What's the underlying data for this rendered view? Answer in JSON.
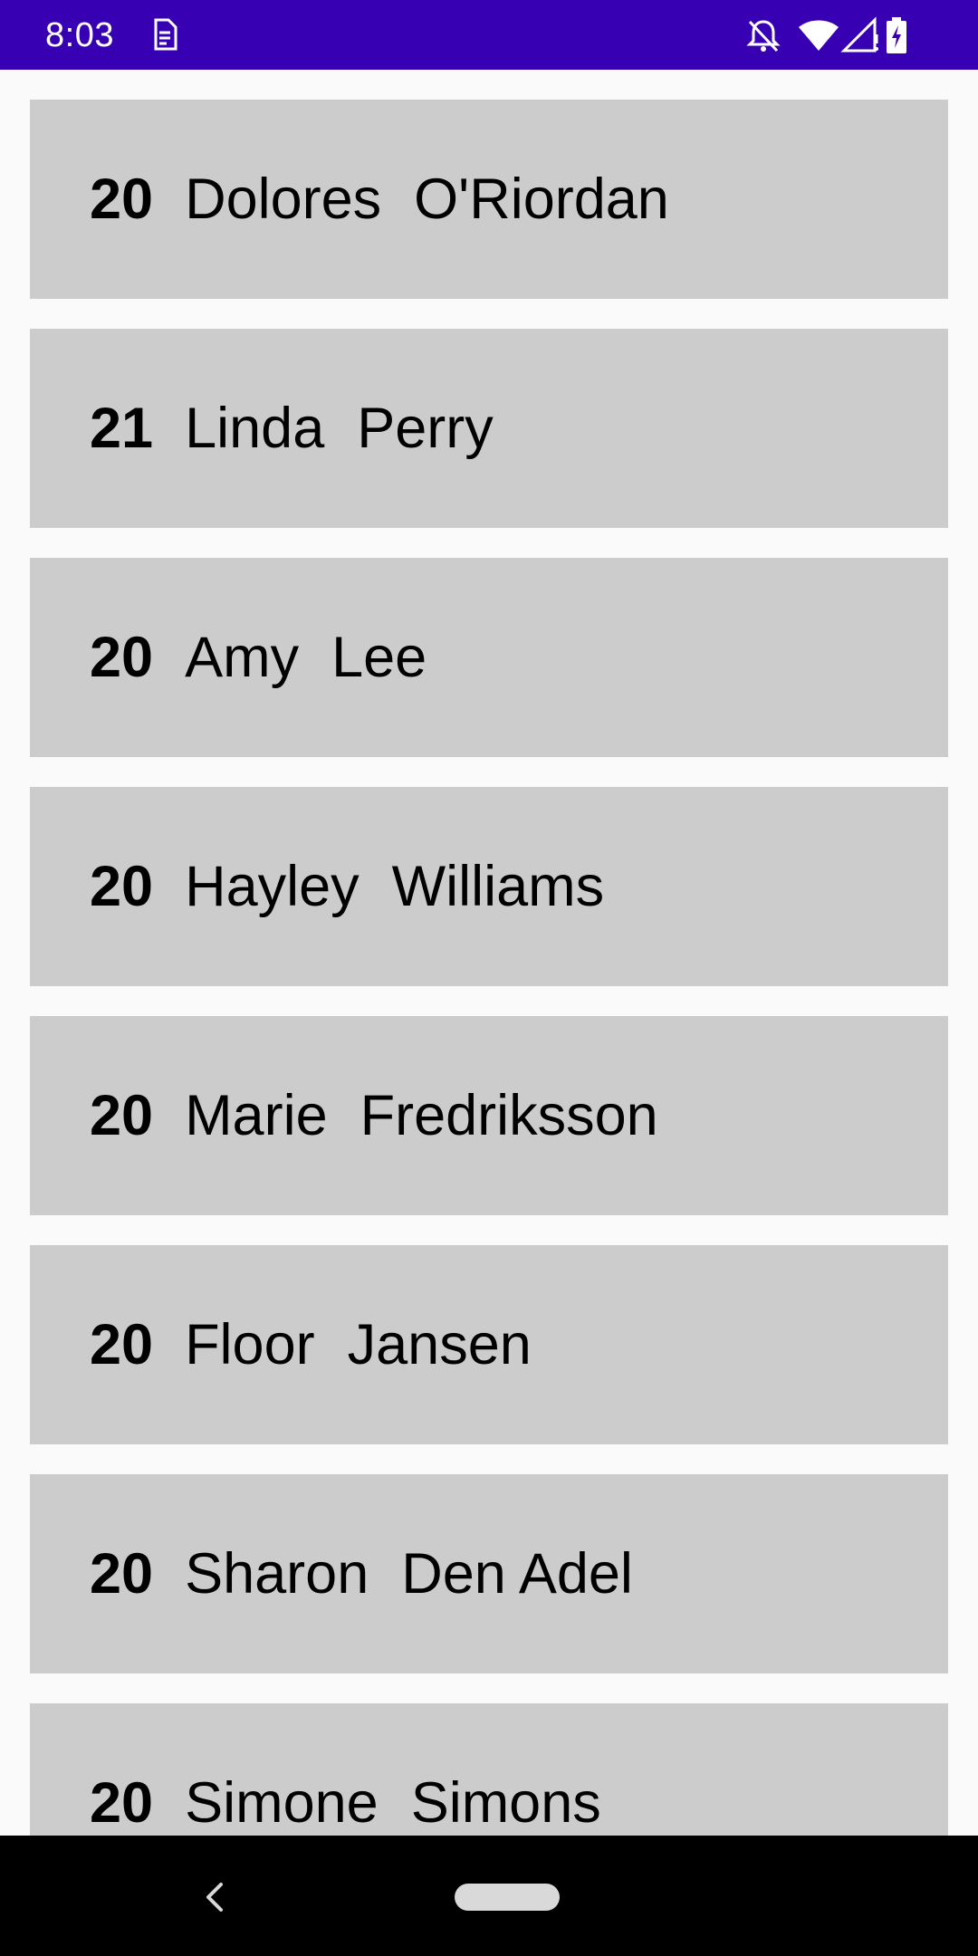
{
  "colors": {
    "status_bar": "#3700b3",
    "card": "#cccccc",
    "background": "#fafafa",
    "nav_bar": "#000000"
  },
  "status_bar": {
    "time": "8:03",
    "left_icon": "sim-card-icon",
    "right_icons": [
      "notifications-off-icon",
      "wifi-icon",
      "signal-icon",
      "battery-charging-icon"
    ]
  },
  "list": {
    "items": [
      {
        "age": "20",
        "first_name": "Dolores",
        "last_name": "O'Riordan"
      },
      {
        "age": "21",
        "first_name": "Linda",
        "last_name": "Perry"
      },
      {
        "age": "20",
        "first_name": "Amy",
        "last_name": "Lee"
      },
      {
        "age": "20",
        "first_name": "Hayley",
        "last_name": "Williams"
      },
      {
        "age": "20",
        "first_name": "Marie",
        "last_name": "Fredriksson"
      },
      {
        "age": "20",
        "first_name": "Floor",
        "last_name": "Jansen"
      },
      {
        "age": "20",
        "first_name": "Sharon",
        "last_name": "Den Adel"
      },
      {
        "age": "20",
        "first_name": "Simone",
        "last_name": "Simons"
      }
    ]
  },
  "nav_bar": {
    "back_icon": "back-chevron-icon",
    "home_icon": "home-pill-icon"
  }
}
